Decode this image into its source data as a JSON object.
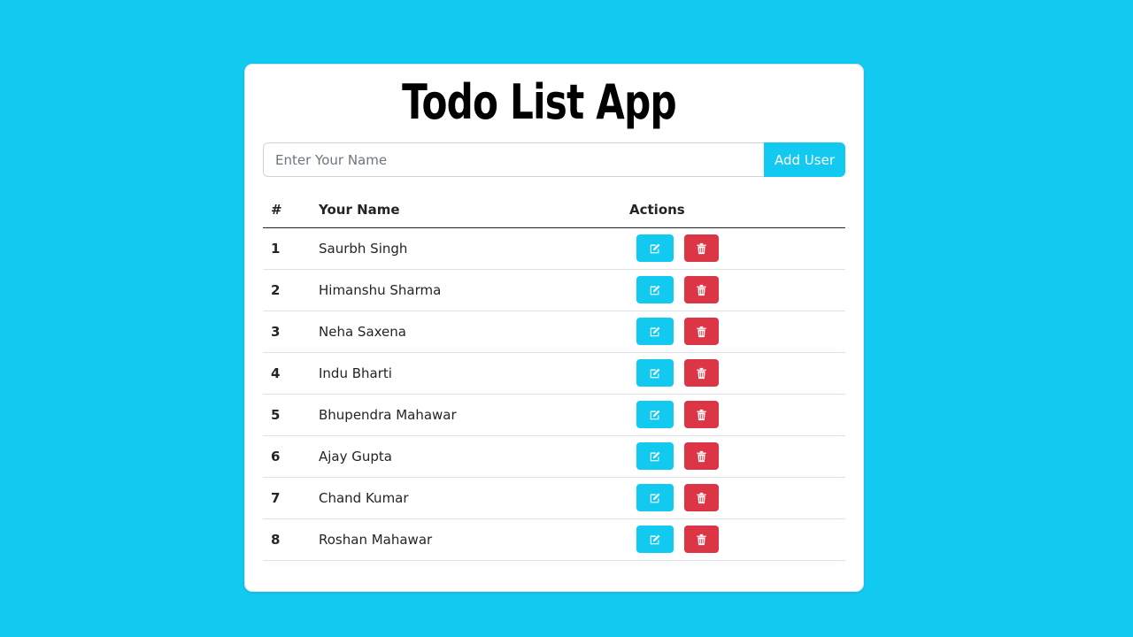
{
  "app": {
    "title": "Todo List App"
  },
  "form": {
    "placeholder": "Enter Your Name",
    "value": "",
    "add_label": "Add User"
  },
  "table": {
    "headers": {
      "index": "#",
      "name": "Your Name",
      "actions": "Actions"
    },
    "rows": [
      {
        "index": "1",
        "name": "Saurbh Singh"
      },
      {
        "index": "2",
        "name": "Himanshu Sharma"
      },
      {
        "index": "3",
        "name": "Neha Saxena"
      },
      {
        "index": "4",
        "name": "Indu Bharti"
      },
      {
        "index": "5",
        "name": "Bhupendra Mahawar"
      },
      {
        "index": "6",
        "name": "Ajay Gupta"
      },
      {
        "index": "7",
        "name": "Chand Kumar"
      },
      {
        "index": "8",
        "name": "Roshan Mahawar"
      }
    ],
    "row_actions": {
      "edit_icon": "edit-icon",
      "delete_icon": "trash-icon"
    }
  },
  "colors": {
    "background": "#12caf0",
    "edit_button": "#12caf0",
    "delete_button": "#dc3545",
    "add_button": "#12caf0"
  }
}
